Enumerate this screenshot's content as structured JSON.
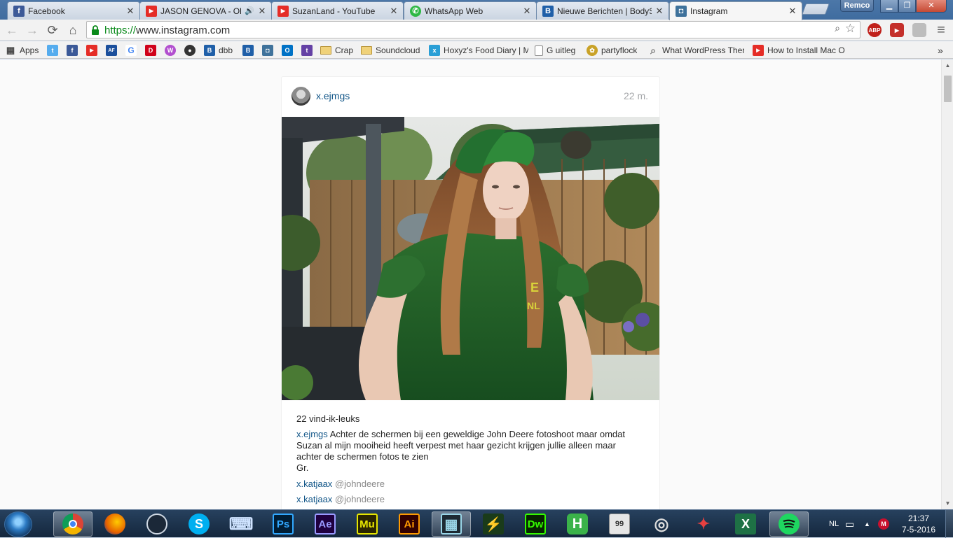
{
  "tabs": [
    {
      "title": "Facebook",
      "icon": "facebook-icon",
      "color": "#3b5998",
      "glyph": "f"
    },
    {
      "title": "JASON GENOVA - Ol",
      "icon": "youtube-icon",
      "color": "#e52d27",
      "glyph": "▶",
      "audio": "🔊"
    },
    {
      "title": "SuzanLand - YouTube",
      "icon": "youtube-icon",
      "color": "#e52d27",
      "glyph": "▶"
    },
    {
      "title": "WhatsApp Web",
      "icon": "whatsapp-icon",
      "color": "#2fb845",
      "glyph": "✆"
    },
    {
      "title": "Nieuwe Berichten | BodyS",
      "icon": "bodyspace-icon",
      "color": "#1f5fa8",
      "glyph": "B"
    },
    {
      "title": "Instagram",
      "icon": "instagram-icon",
      "color": "#3f729b",
      "glyph": "◘"
    }
  ],
  "tab_close": "✕",
  "profile_name": "Remco",
  "window_controls": {
    "minimize": "▁",
    "maximize": "❐",
    "close": "✕"
  },
  "toolbar": {
    "back": "←",
    "forward": "→",
    "reload": "⟳",
    "home": "⌂",
    "url_scheme": "https://",
    "url_rest": "www.instagram.com",
    "search_glyph": "🔍",
    "star_glyph": "☆",
    "menu_glyph": "≡",
    "abp": "ABP"
  },
  "bookmarks": [
    {
      "label": "Apps",
      "icon": "apps-grid-icon",
      "color": "#555555",
      "glyph": "⁞⁞"
    },
    {
      "label": "",
      "icon": "twitter-icon",
      "color": "#55acee",
      "glyph": "t"
    },
    {
      "label": "",
      "icon": "facebook-icon",
      "color": "#3b5998",
      "glyph": "f"
    },
    {
      "label": "",
      "icon": "youtube-icon",
      "color": "#e52d27",
      "glyph": "▶"
    },
    {
      "label": "",
      "icon": "af-icon",
      "color": "#1b4f9c",
      "glyph": "AF"
    },
    {
      "label": "",
      "icon": "google-icon",
      "color": "#4285f4",
      "glyph": "G"
    },
    {
      "label": "",
      "icon": "d-icon",
      "color": "#d0021b",
      "glyph": "D"
    },
    {
      "label": "",
      "icon": "w-icon",
      "color": "#b24fcf",
      "glyph": "W"
    },
    {
      "label": "",
      "icon": "steam-icon",
      "color": "#333333",
      "glyph": "●"
    },
    {
      "label": "dbb",
      "icon": "bodyspace-icon",
      "color": "#1f5fa8",
      "glyph": "B"
    },
    {
      "label": "",
      "icon": "bodyspace-icon",
      "color": "#1f5fa8",
      "glyph": "B"
    },
    {
      "label": "",
      "icon": "instagram-icon",
      "color": "#3f729b",
      "glyph": "◘"
    },
    {
      "label": "",
      "icon": "outlook-icon",
      "color": "#0072c6",
      "glyph": "O"
    },
    {
      "label": "",
      "icon": "twitch-icon",
      "color": "#6441a5",
      "glyph": "t"
    },
    {
      "label": "Crap",
      "icon": "folder-icon",
      "color": "#e8c25a",
      "glyph": ""
    },
    {
      "label": "Soundcloud",
      "icon": "folder-icon",
      "color": "#e8c25a",
      "glyph": ""
    },
    {
      "label": "Hoxyz's Food Diary | M",
      "icon": "x-icon",
      "color": "#2a9fd6",
      "glyph": "x"
    },
    {
      "label": "G uitleg",
      "icon": "page-icon",
      "color": "#ffffff",
      "glyph": ""
    },
    {
      "label": "partyflock",
      "icon": "partyflock-icon",
      "color": "#c9a227",
      "glyph": "✿"
    },
    {
      "label": "What WordPress Ther",
      "icon": "search-page-icon",
      "color": "#9e9e9e",
      "glyph": "⌕"
    },
    {
      "label": "How to Install Mac O",
      "icon": "youtube-icon",
      "color": "#e52d27",
      "glyph": "▶"
    }
  ],
  "bookmarks_more": "»",
  "post": {
    "username": "x.ejmgs",
    "time_ago": "22 m.",
    "likes": "22 vind-ik-leuks",
    "caption_user": "x.ejmgs",
    "caption_lines": [
      "Achter de schermen bij een geweldige John Deere fotoshoot maar omdat",
      "Suzan al mijn mooiheid heeft verpest met haar gezicht krijgen jullie alleen maar",
      "achter de schermen fotos te zien",
      "Gr."
    ],
    "comments": [
      {
        "user": "x.katjaax",
        "text": "@johndeere"
      },
      {
        "user": "x.katjaax",
        "text": "@johndeere"
      }
    ]
  },
  "scroll": {
    "up": "▲",
    "down": "▼"
  },
  "taskbar": {
    "apps": [
      {
        "name": "chrome",
        "icon": "chrome-icon",
        "color": "#e8b70e",
        "label": "",
        "active": true
      },
      {
        "name": "firefox",
        "icon": "firefox-icon",
        "color": "#e66000",
        "label": ""
      },
      {
        "name": "steam",
        "icon": "steam-icon",
        "color": "#1b2838",
        "label": ""
      },
      {
        "name": "skype",
        "icon": "skype-icon",
        "color": "#00aff0",
        "label": "S"
      },
      {
        "name": "on-screen-keyboard",
        "icon": "keyboard-icon",
        "color": "#8ab4e0",
        "label": "⌨"
      },
      {
        "name": "photoshop",
        "icon": "photoshop-icon",
        "color": "#31a8ff",
        "label": "Ps"
      },
      {
        "name": "after-effects",
        "icon": "after-effects-icon",
        "color": "#9999ff",
        "label": "Ae"
      },
      {
        "name": "muse",
        "icon": "muse-icon",
        "color": "#e6e600",
        "label": "Mu"
      },
      {
        "name": "illustrator",
        "icon": "illustrator-icon",
        "color": "#ff9a00",
        "label": "Ai"
      },
      {
        "name": "premiere",
        "icon": "film-icon",
        "color": "#9ad6e8",
        "label": "▦"
      },
      {
        "name": "mediafire",
        "icon": "mediafire-icon",
        "color": "#5fd35f",
        "label": "⚡"
      },
      {
        "name": "dreamweaver",
        "icon": "dreamweaver-icon",
        "color": "#35fa00",
        "label": "Dw"
      },
      {
        "name": "h-app",
        "icon": "h-app-icon",
        "color": "#3bb34a",
        "label": "H"
      },
      {
        "name": "99-app",
        "icon": "presentation-icon",
        "color": "#d9d9d9",
        "label": "99"
      },
      {
        "name": "rockstar",
        "icon": "rockstar-icon",
        "color": "#cccccc",
        "label": "◎"
      },
      {
        "name": "game-app",
        "icon": "game-icon",
        "color": "#e84040",
        "label": "✦"
      },
      {
        "name": "excel",
        "icon": "excel-icon",
        "color": "#1e7145",
        "label": "X"
      },
      {
        "name": "spotify",
        "icon": "spotify-icon",
        "color": "#1ed760",
        "label": "",
        "active": true
      }
    ],
    "language": "NL",
    "time": "21:37",
    "date": "7-5-2016"
  }
}
